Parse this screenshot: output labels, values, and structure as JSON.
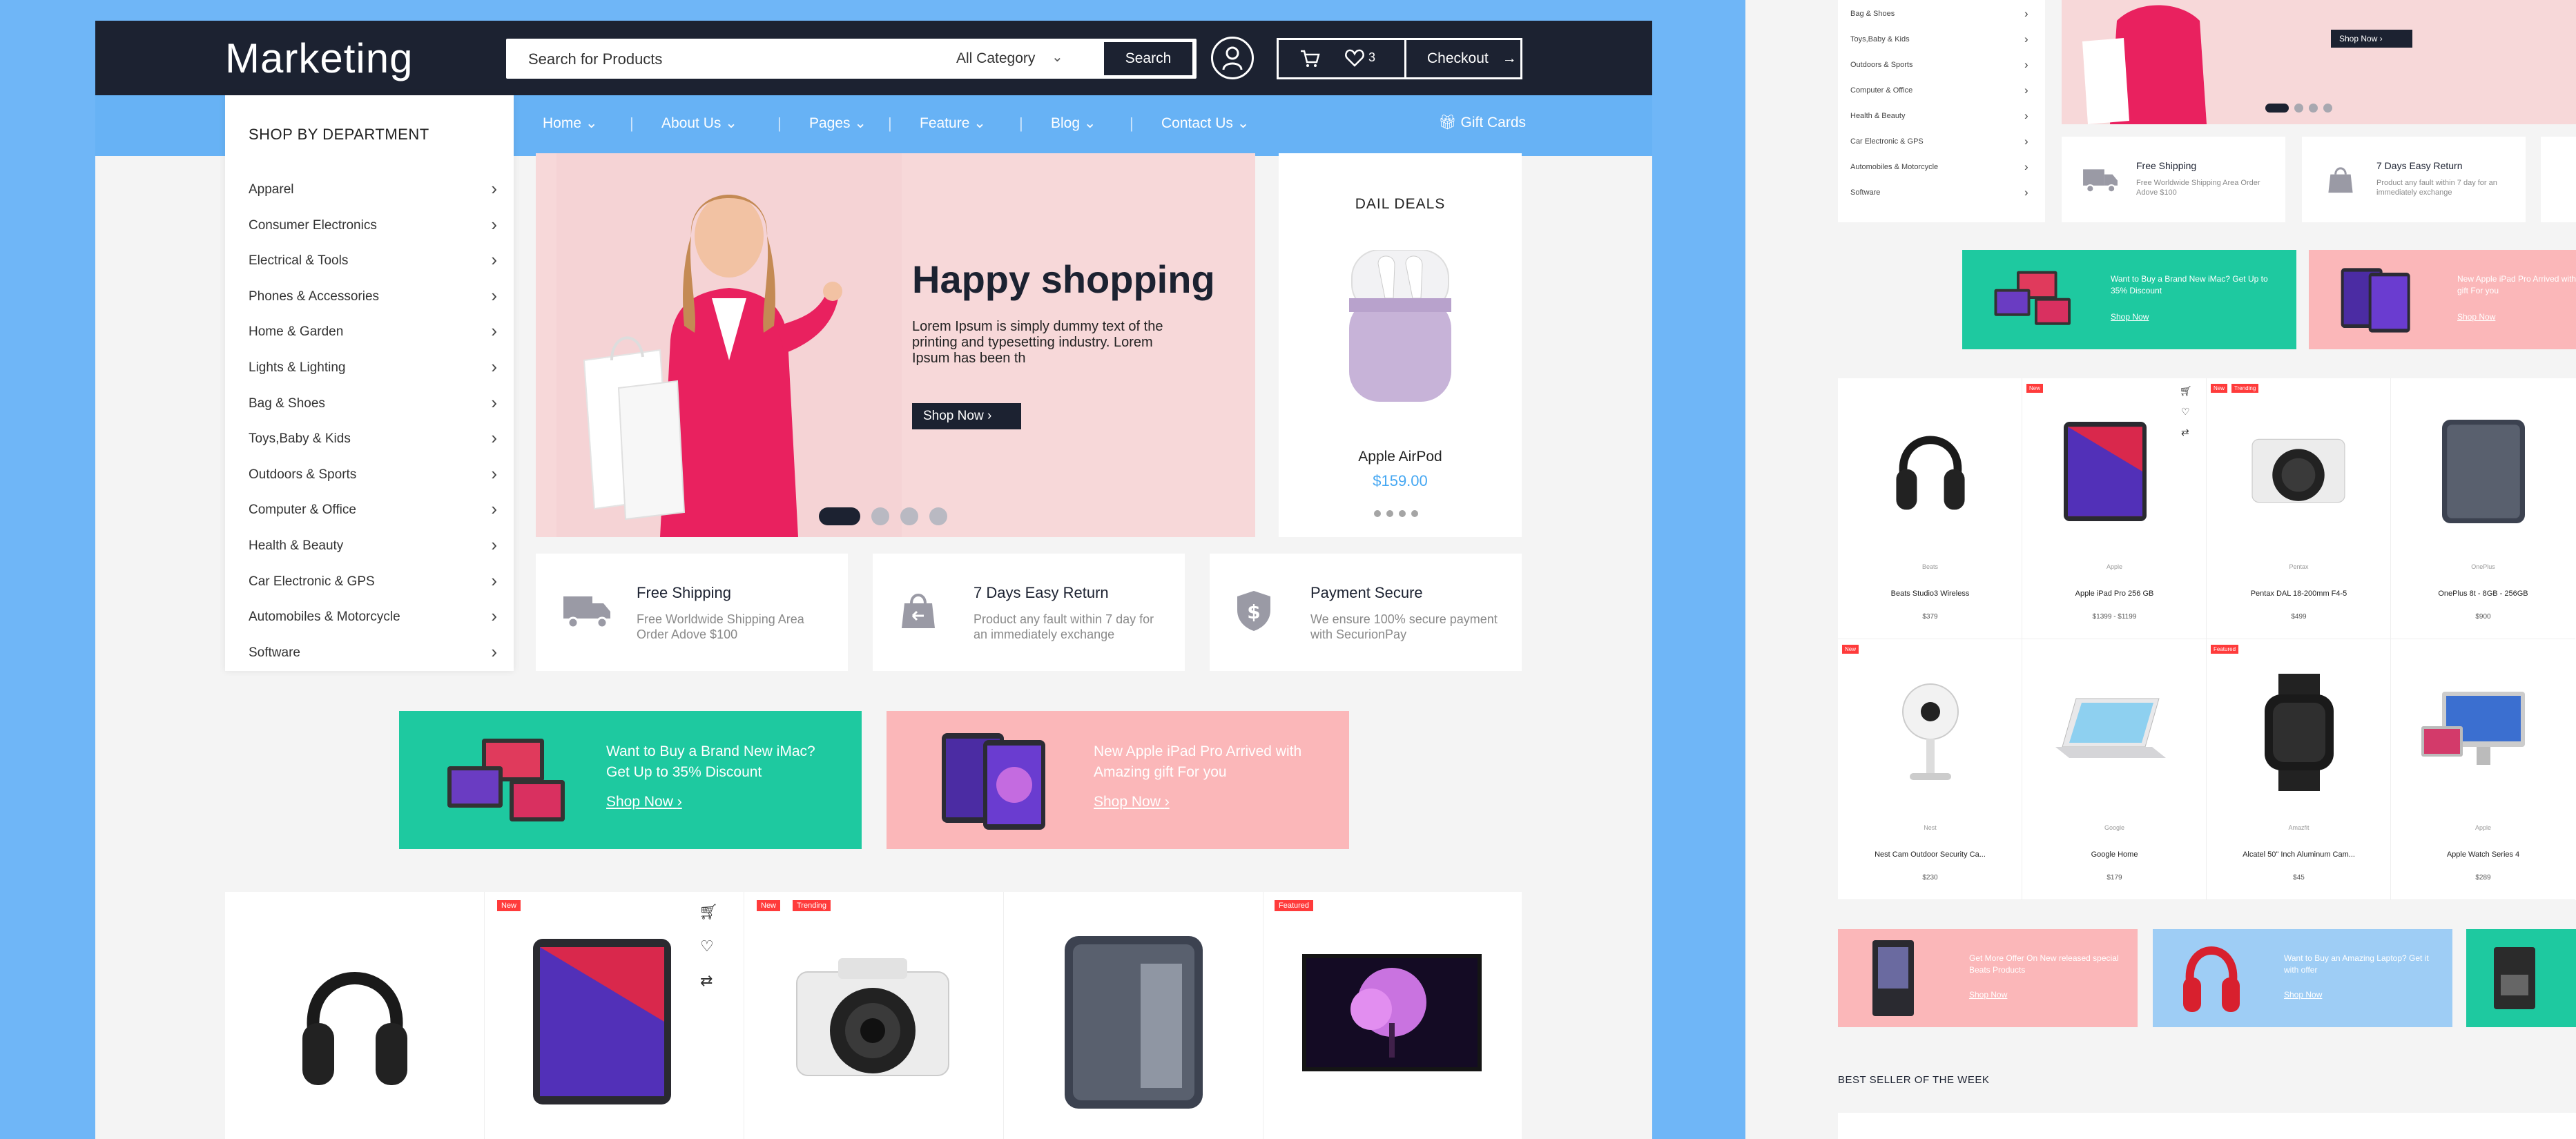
{
  "header": {
    "brand": "Marketing",
    "search_placeholder": "Search for Products",
    "category": "All Category",
    "search_button": "Search",
    "wishlist_count": "3",
    "checkout": "Checkout"
  },
  "nav": {
    "items": [
      "Home",
      "About Us",
      "Pages",
      "Feature",
      "Blog",
      "Contact Us"
    ],
    "gift": "Gift Cards"
  },
  "department": {
    "title": "SHOP BY DEPARTMENT",
    "items": [
      "Apparel",
      "Consumer Electronics",
      "Electrical & Tools",
      "Phones & Accessories",
      "Home & Garden",
      "Lights & Lighting",
      "Bag & Shoes",
      "Toys,Baby & Kids",
      "Outdoors & Sports",
      "Computer & Office",
      "Health & Beauty",
      "Car Electronic & GPS",
      "Automobiles & Motorcycle",
      "Software"
    ]
  },
  "hero": {
    "title": "Happy shopping",
    "desc": "Lorem Ipsum is simply dummy text of the printing and typesetting industry. Lorem Ipsum has been th",
    "button": "Shop Now"
  },
  "deal": {
    "title": "DAIL DEALS",
    "product": "Apple AirPod",
    "price": "$159.00"
  },
  "features": [
    {
      "title": "Free Shipping",
      "desc": "Free Worldwide Shipping Area Order Adove $100"
    },
    {
      "title": "7 Days Easy Return",
      "desc": "Product any fault within 7 day for an immediately exchange"
    },
    {
      "title": "Payment Secure",
      "desc": "We ensure 100% secure payment with SecurionPay"
    }
  ],
  "banners": [
    {
      "title": "Want to Buy a Brand New iMac? Get Up to 35% Discount",
      "link": "Shop Now",
      "color": "#1ec9a0"
    },
    {
      "title": "New Apple iPad Pro Arrived with Amazing gift For you",
      "link": "Shop Now",
      "color": "#fbb7b9"
    }
  ],
  "product_badges": {
    "new": "New",
    "trending": "Trending",
    "featured": "Featured"
  },
  "mock2": {
    "dept_items": [
      "Bag & Shoes",
      "Toys,Baby & Kids",
      "Outdoors & Sports",
      "Computer & Office",
      "Health & Beauty",
      "Car Electronic & GPS",
      "Automobiles & Motorcycle",
      "Software"
    ],
    "hero_button": "Shop Now",
    "features": [
      {
        "title": "Free Shipping",
        "desc": "Free Worldwide Shipping Area Order Adove $100"
      },
      {
        "title": "7 Days Easy Return",
        "desc": "Product any fault within 7 day for an immediately exchange"
      }
    ],
    "banners": [
      {
        "title": "Want to Buy a Brand New iMac? Get Up to 35% Discount",
        "link": "Shop Now"
      },
      {
        "title": "New Apple iPad Pro Arrived with Amazing gift For you",
        "link": "Shop Now"
      }
    ],
    "products": [
      {
        "brand": "Beats",
        "name": "Beats Studio3 Wireless",
        "price": "$379"
      },
      {
        "brand": "Apple",
        "name": "Apple iPad Pro 256 GB",
        "price": "$1399 - $1199"
      },
      {
        "brand": "Pentax",
        "name": "Pentax DAL 18-200mm F4-5",
        "price": "$499"
      },
      {
        "brand": "OnePlus",
        "name": "OnePlus 8t - 8GB - 256GB",
        "price": "$900"
      },
      {
        "brand": "Nest",
        "name": "Nest Cam Outdoor Security Ca...",
        "price": "$230"
      },
      {
        "brand": "Google",
        "name": "Google Home",
        "price": "$179"
      },
      {
        "brand": "Amazfit",
        "name": "Alcatel 50\" Inch Aluminum Cam...",
        "price": "$45"
      },
      {
        "brand": "Apple",
        "name": "Apple Watch Series 4",
        "price": "$289"
      }
    ],
    "banners2": [
      {
        "title": "Get More Offer On New released special Beats Products",
        "link": "Shop Now"
      },
      {
        "title": "Want to Buy an Amazing Laptop? Get it with offer",
        "link": "Shop Now"
      }
    ],
    "best_seller": "BEST SELLER OF THE WEEK"
  }
}
